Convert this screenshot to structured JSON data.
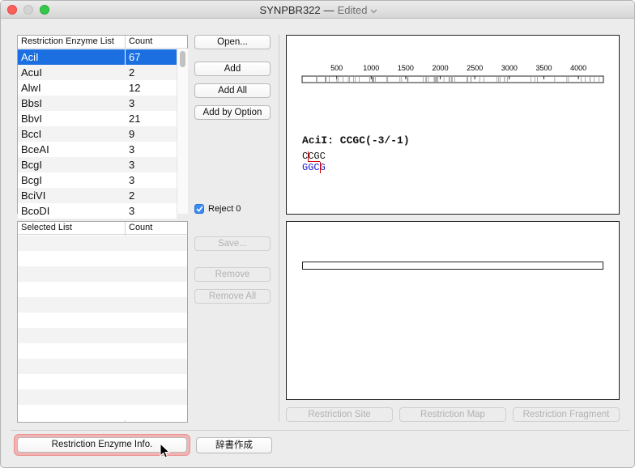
{
  "window": {
    "title": "SYNPBR322",
    "separator": "—",
    "status": "Edited"
  },
  "enzyme_list": {
    "headers": [
      "Restriction Enzyme List",
      "Count"
    ],
    "rows": [
      [
        "AciI",
        "67"
      ],
      [
        "AcuI",
        "2"
      ],
      [
        "AlwI",
        "12"
      ],
      [
        "BbsI",
        "3"
      ],
      [
        "BbvI",
        "21"
      ],
      [
        "BccI",
        "9"
      ],
      [
        "BceAI",
        "3"
      ],
      [
        "BcgI",
        "3"
      ],
      [
        "BcgI",
        "3"
      ],
      [
        "BciVI",
        "2"
      ],
      [
        "BcoDI",
        "3"
      ]
    ],
    "selected_index": 0
  },
  "selected_list": {
    "headers": [
      "Selected List",
      "Count"
    ]
  },
  "buttons": {
    "open": "Open...",
    "add": "Add",
    "add_all": "Add All",
    "add_by_option": "Add by Option",
    "save": "Save...",
    "remove": "Remove",
    "remove_all": "Remove All",
    "restriction_site": "Restriction Site",
    "restriction_map": "Restriction Map",
    "restriction_fragment": "Restriction Fragment",
    "restriction_info": "Restriction Enzyme Info.",
    "dictionary": "辞書作成"
  },
  "reject": {
    "label": "Reject 0",
    "checked": true
  },
  "map": {
    "ticks": [
      "500",
      "1000",
      "1500",
      "2000",
      "2500",
      "3000",
      "3500",
      "4000"
    ],
    "tick_values": [
      500,
      1000,
      1500,
      2000,
      2500,
      3000,
      3500,
      4000
    ],
    "length": 4362
  },
  "site": {
    "title": "AciI: CCGC(-3/-1)",
    "top_seq": "CCGC",
    "bottom_seq": "GGCG"
  },
  "colors": {
    "selection": "#1b6fe0",
    "accent_blue": "#1a1acc",
    "cut_red": "#d00000",
    "focus_ring": "#f08a8a"
  }
}
